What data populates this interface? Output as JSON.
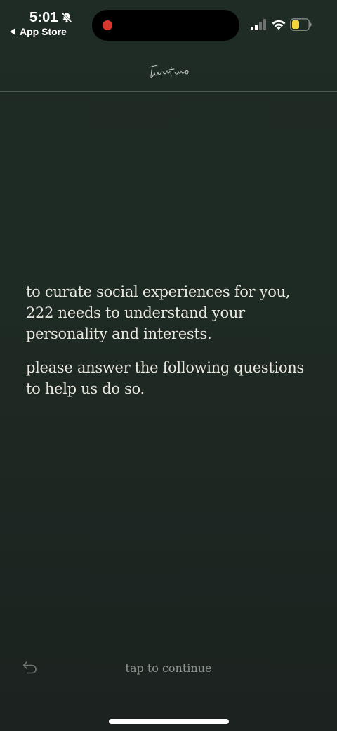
{
  "status_bar": {
    "time": "5:01",
    "back_label": "App Store",
    "battery_color": "#f5d33a",
    "recording_color": "#d6382f"
  },
  "header": {
    "logo_text": "twotwotwo"
  },
  "intro": {
    "paragraph_1": "to curate social experiences for you, 222 needs to understand your personality and interests.",
    "paragraph_2": "please answer the following questions to help us do so."
  },
  "footer": {
    "continue_label": "tap to continue"
  },
  "icons": [
    "bell-off-icon",
    "back-triangle-icon",
    "signal-icon",
    "wifi-icon",
    "battery-icon",
    "undo-icon"
  ]
}
